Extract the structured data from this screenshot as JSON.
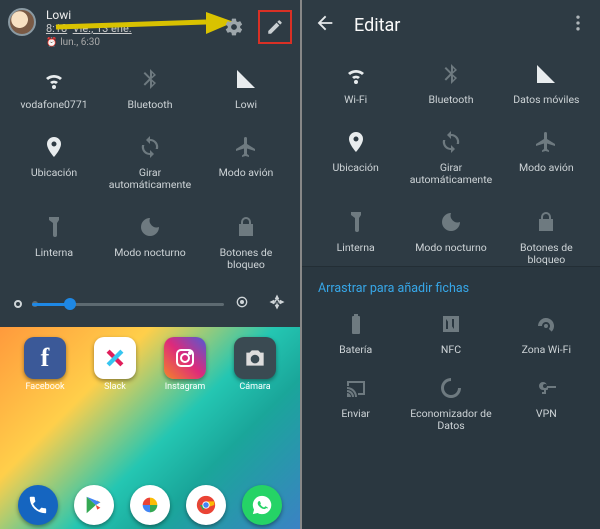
{
  "left": {
    "carrier": "Lowi",
    "clock_time": "8:18",
    "clock_date": "Vie., 13 ene.",
    "alarm": "lun., 6:30",
    "tiles": [
      {
        "label": "vodafone0771",
        "icon": "wifi",
        "state": "on"
      },
      {
        "label": "Bluetooth",
        "icon": "bluetooth",
        "state": "off"
      },
      {
        "label": "Lowi",
        "icon": "signal",
        "state": "on"
      },
      {
        "label": "Ubicación",
        "icon": "location",
        "state": "on"
      },
      {
        "label": "Girar automáticamente",
        "icon": "rotate",
        "state": "off"
      },
      {
        "label": "Modo avión",
        "icon": "airplane",
        "state": "off"
      },
      {
        "label": "Linterna",
        "icon": "flashlight",
        "state": "off"
      },
      {
        "label": "Modo nocturno",
        "icon": "night",
        "state": "off"
      },
      {
        "label": "Botones de bloqueo",
        "icon": "lock",
        "state": "off"
      }
    ],
    "brightness_pct": 20,
    "apps_row": [
      {
        "label": "Facebook",
        "bg": "#3b5998",
        "icon": "f"
      },
      {
        "label": "Slack",
        "bg": "#ffffff",
        "icon": "slack"
      },
      {
        "label": "Instagram",
        "bg": "linear-gradient(45deg,#f58529,#dd2a7b,#515bd4)",
        "icon": "ig"
      },
      {
        "label": "Cámara",
        "bg": "#3a4a52",
        "icon": "cam"
      }
    ],
    "dock": [
      {
        "bg": "#1565c0",
        "icon": "phone"
      },
      {
        "bg": "#ffffff",
        "icon": "play"
      },
      {
        "bg": "#ffffff",
        "icon": "photos"
      },
      {
        "bg": "#ffffff",
        "icon": "chrome"
      },
      {
        "bg": "#25d366",
        "icon": "whatsapp"
      }
    ]
  },
  "right": {
    "title": "Editar",
    "tiles_main": [
      {
        "label": "Wi-Fi",
        "icon": "wifi",
        "state": "on"
      },
      {
        "label": "Bluetooth",
        "icon": "bluetooth",
        "state": "off"
      },
      {
        "label": "Datos móviles",
        "icon": "signal",
        "state": "on"
      },
      {
        "label": "Ubicación",
        "icon": "location",
        "state": "on"
      },
      {
        "label": "Girar automáticamente",
        "icon": "rotate",
        "state": "off"
      },
      {
        "label": "Modo avión",
        "icon": "airplane",
        "state": "off"
      },
      {
        "label": "Linterna",
        "icon": "flashlight",
        "state": "off"
      },
      {
        "label": "Modo nocturno",
        "icon": "night",
        "state": "off"
      },
      {
        "label": "Botones de bloqueo",
        "icon": "lock",
        "state": "off"
      }
    ],
    "hint": "Arrastrar para añadir fichas",
    "tiles_extra": [
      {
        "label": "Batería",
        "icon": "battery"
      },
      {
        "label": "NFC",
        "icon": "nfc"
      },
      {
        "label": "Zona Wi-Fi",
        "icon": "hotspot"
      },
      {
        "label": "Enviar",
        "icon": "cast"
      },
      {
        "label": "Economizador de Datos",
        "icon": "datasaver"
      },
      {
        "label": "VPN",
        "icon": "vpn"
      }
    ]
  }
}
